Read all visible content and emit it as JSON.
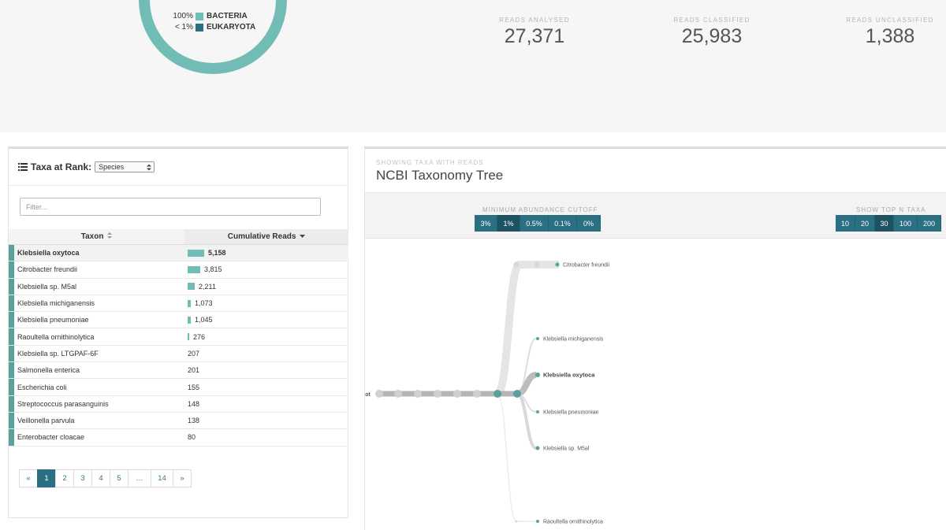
{
  "summary": {
    "legend": [
      {
        "pct": "100%",
        "name": "BACTERIA",
        "color": "#72bcb6"
      },
      {
        "pct": "< 1%",
        "name": "EUKARYOTA",
        "color": "#2a6f82"
      }
    ],
    "stats": [
      {
        "label": "READS ANALYSED",
        "value": "27,371"
      },
      {
        "label": "READS CLASSIFIED",
        "value": "25,983"
      },
      {
        "label": "READS UNCLASSIFIED",
        "value": "1,388"
      }
    ]
  },
  "taxa_panel": {
    "title": "Taxa at Rank:",
    "rank_selected": "Species",
    "filter_placeholder": "Filter...",
    "col_taxon": "Taxon",
    "col_reads": "Cumulative Reads",
    "rows": [
      {
        "taxon": "Klebsiella oxytoca",
        "reads": "5,158",
        "frac": 1.0
      },
      {
        "taxon": "Citrobacter freundii",
        "reads": "3,815",
        "frac": 0.74
      },
      {
        "taxon": "Klebsiella sp. M5al",
        "reads": "2,211",
        "frac": 0.43
      },
      {
        "taxon": "Klebsiella michiganensis",
        "reads": "1,073",
        "frac": 0.21
      },
      {
        "taxon": "Klebsiella pneumoniae",
        "reads": "1,045",
        "frac": 0.2
      },
      {
        "taxon": "Raoultella ornithinolytica",
        "reads": "276",
        "frac": 0.05
      },
      {
        "taxon": "Klebsiella sp. LTGPAF-6F",
        "reads": "207",
        "frac": 0
      },
      {
        "taxon": "Salmonella enterica",
        "reads": "201",
        "frac": 0
      },
      {
        "taxon": "Escherichia coli",
        "reads": "155",
        "frac": 0
      },
      {
        "taxon": "Streptococcus parasanguinis",
        "reads": "148",
        "frac": 0
      },
      {
        "taxon": "Veillonella parvula",
        "reads": "138",
        "frac": 0
      },
      {
        "taxon": "Enterobacter cloacae",
        "reads": "80",
        "frac": 0
      }
    ],
    "pagination": [
      "«",
      "1",
      "2",
      "3",
      "4",
      "5",
      "…",
      "14",
      "»"
    ],
    "current_page": "1"
  },
  "tree_panel": {
    "subtitle": "SHOWING TAXA WITH READS",
    "title": "NCBI Taxonomy Tree",
    "cutoff_label": "MINIMUM ABUNDANCE CUTOFF",
    "cutoff_options": [
      "3%",
      "1%",
      "0.5%",
      "0.1%",
      "0%"
    ],
    "cutoff_selected": "1%",
    "topn_label": "SHOW TOP N TAXA",
    "topn_options": [
      "10",
      "20",
      "30",
      "100",
      "200"
    ],
    "topn_selected": "30",
    "root_label": "oot",
    "leaves": [
      {
        "name": "Citrobacter freundii",
        "bold": false
      },
      {
        "name": "Klebsiella michiganensis",
        "bold": false
      },
      {
        "name": "Klebsiella oxytoca",
        "bold": true
      },
      {
        "name": "Klebsiella pneumoniae",
        "bold": false
      },
      {
        "name": "Klebsiella sp. M5al",
        "bold": false
      },
      {
        "name": "Raoultella ornithinolytica",
        "bold": false
      }
    ]
  },
  "colors": {
    "teal_light": "#72bcb6",
    "teal_dark": "#2a6f82"
  }
}
